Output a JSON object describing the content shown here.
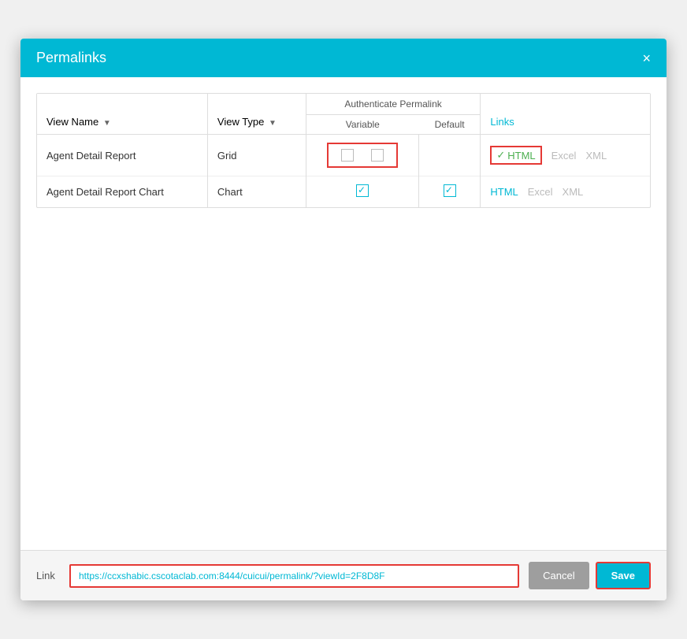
{
  "modal": {
    "title": "Permalinks",
    "close_label": "×"
  },
  "table": {
    "col_view_name": "View Name",
    "col_view_type": "View Type",
    "col_auth_permalink": "Authenticate Permalink",
    "col_variable": "Variable",
    "col_default": "Default",
    "col_links": "Links",
    "rows": [
      {
        "view_name": "Agent Detail Report",
        "view_type": "Grid",
        "variable_checked": false,
        "default_checked": false,
        "html_active": true,
        "html_label": "HTML",
        "excel_label": "Excel",
        "xml_label": "XML",
        "excel_active": false,
        "xml_active": false
      },
      {
        "view_name": "Agent Detail Report Chart",
        "view_type": "Chart",
        "variable_checked": true,
        "default_checked": true,
        "html_active": false,
        "html_label": "HTML",
        "excel_label": "Excel",
        "xml_label": "XML",
        "excel_active": false,
        "xml_active": false
      }
    ]
  },
  "footer": {
    "link_label": "Link",
    "link_url": "https://ccxshabic.cscotaclab.com:8444/cuicui/permalink/?viewId=2F8D8F",
    "cancel_label": "Cancel",
    "save_label": "Save"
  }
}
